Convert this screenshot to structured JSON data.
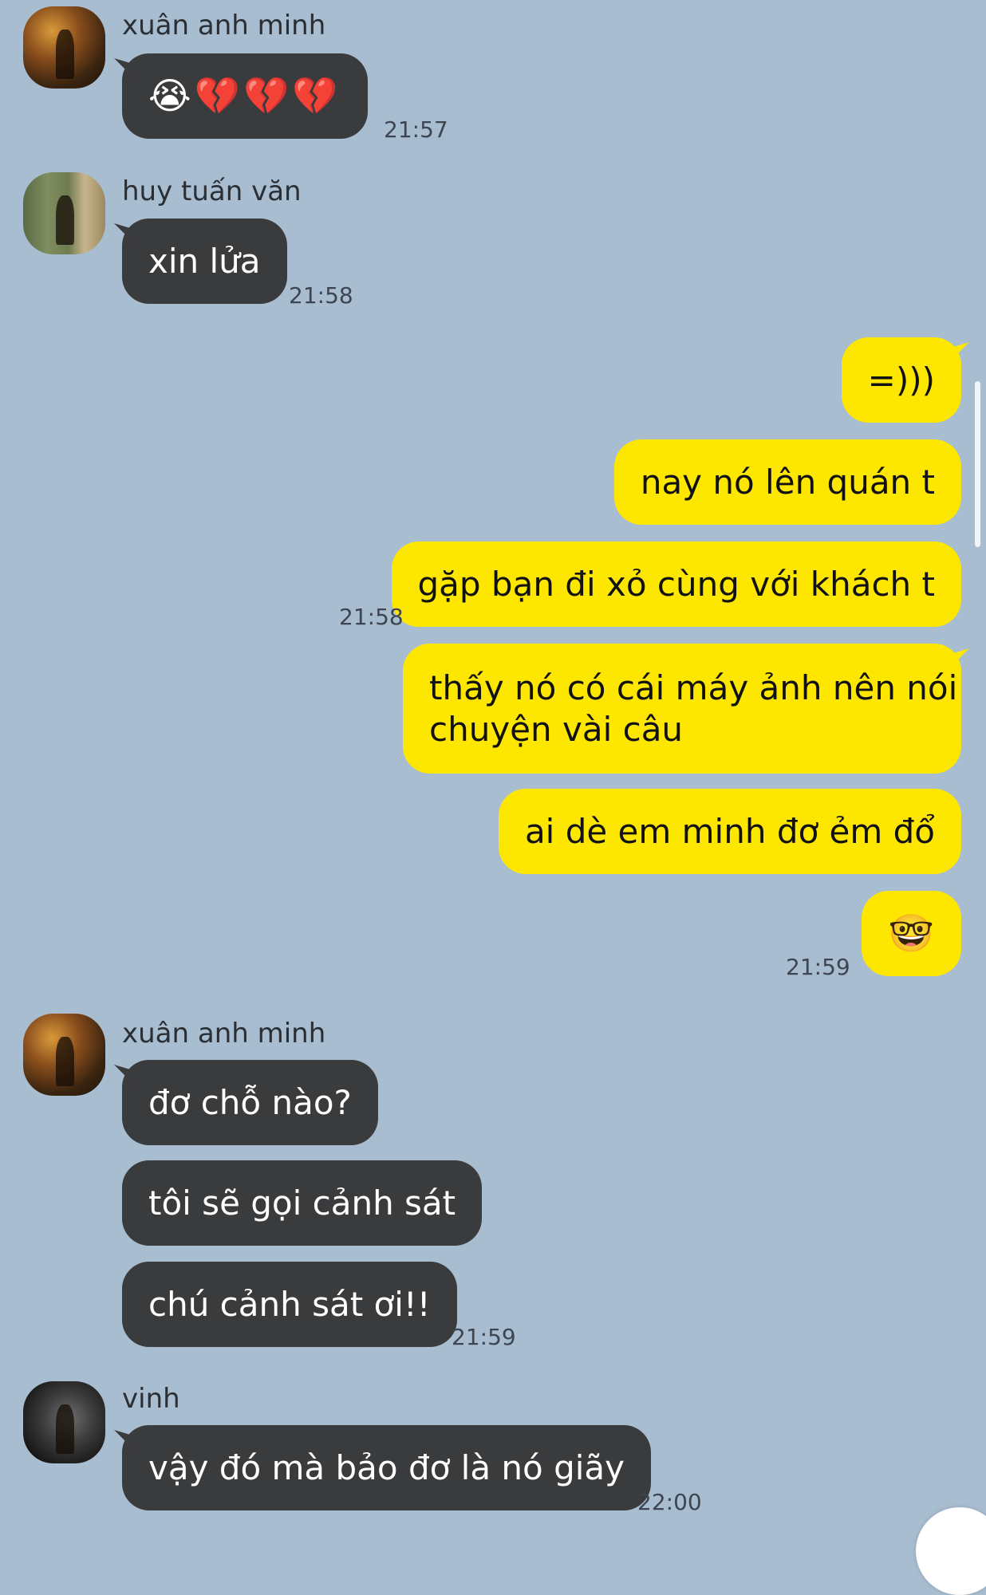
{
  "messages": [
    {
      "sender": "xuân anh minh",
      "texts": [
        "😭💔💔💔"
      ],
      "time": "21:57"
    },
    {
      "sender": "huy tuấn văn",
      "texts": [
        "xin lửa"
      ],
      "time": "21:58"
    },
    {
      "me": true,
      "texts": [
        "=)))",
        "nay nó lên quán t",
        "gặp bạn đi xỏ cùng với khách t"
      ],
      "time": "21:58"
    },
    {
      "me": true,
      "texts": [
        "thấy nó có cái máy ảnh nên nói",
        "chuyện vài câu",
        "ai dè em minh đơ ẻm đổ",
        "🤓"
      ],
      "time": "21:59"
    },
    {
      "sender": "xuân anh minh",
      "texts": [
        "đơ chỗ nào?",
        "tôi sẽ gọi cảnh sát",
        "chú cảnh sát ơi!!"
      ],
      "time": "21:59"
    },
    {
      "sender": "vinh",
      "texts": [
        "vậy đó mà bảo đơ là nó giãy"
      ],
      "time": "22:00"
    }
  ]
}
